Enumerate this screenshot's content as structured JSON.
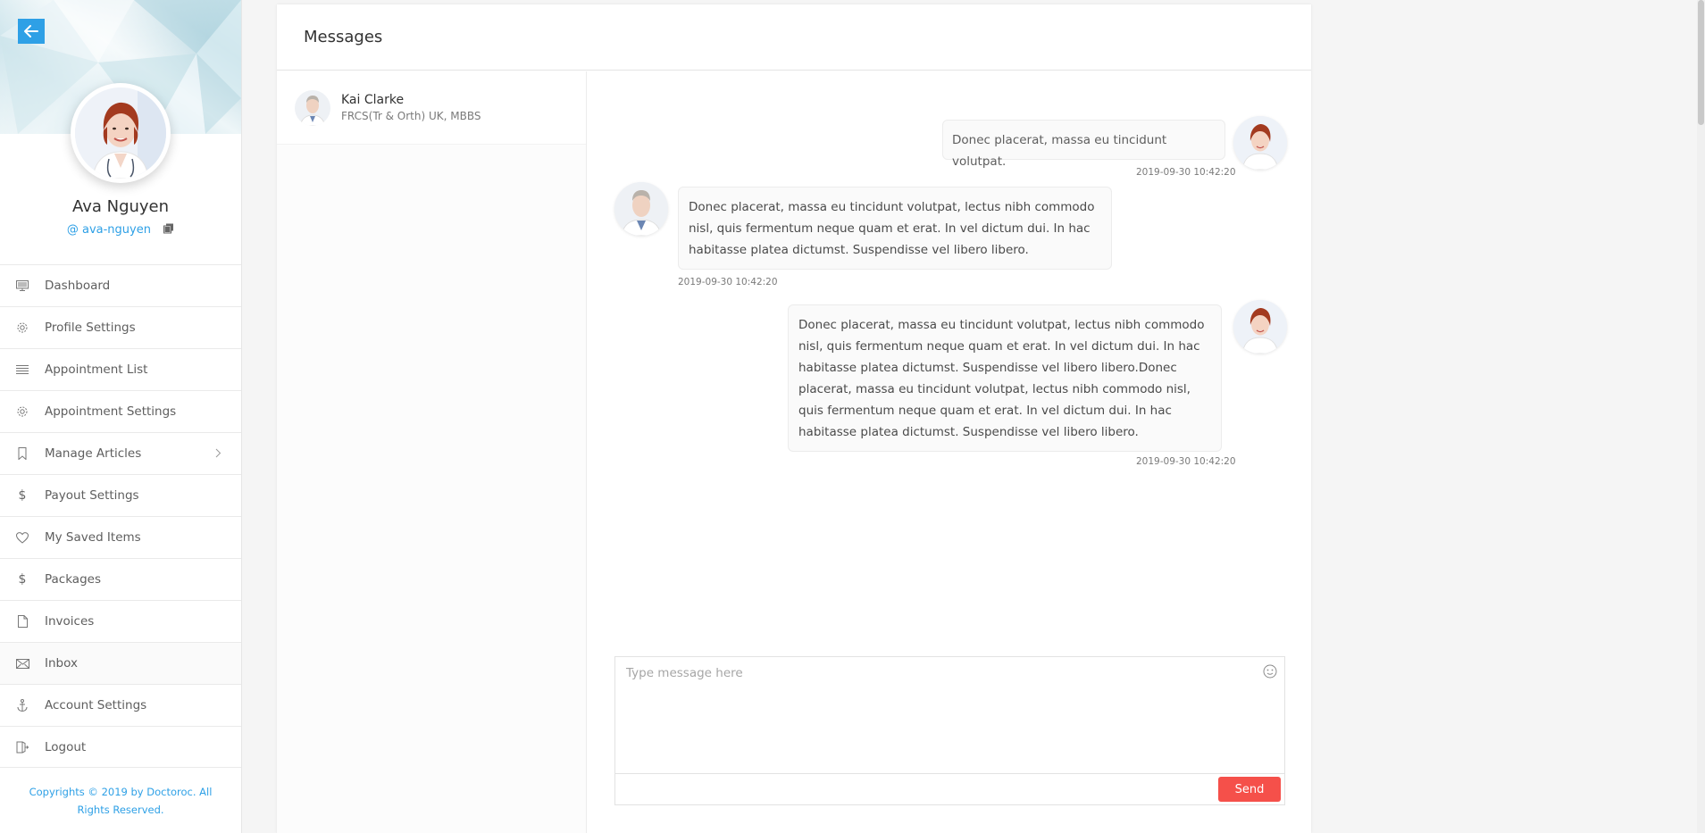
{
  "sidebar": {
    "profile": {
      "name": "Ava Nguyen",
      "handle": "@ ava-nguyen"
    },
    "items": [
      {
        "label": "Dashboard",
        "icon": "monitor-icon"
      },
      {
        "label": "Profile Settings",
        "icon": "gear-icon"
      },
      {
        "label": "Appointment List",
        "icon": "list-icon"
      },
      {
        "label": "Appointment Settings",
        "icon": "gear-icon"
      },
      {
        "label": "Manage Articles",
        "icon": "bookmark-icon",
        "has_submenu": true
      },
      {
        "label": "Payout Settings",
        "icon": "dollar-icon"
      },
      {
        "label": "My Saved Items",
        "icon": "heart-icon"
      },
      {
        "label": "Packages",
        "icon": "dollar-icon"
      },
      {
        "label": "Invoices",
        "icon": "file-icon"
      },
      {
        "label": "Inbox",
        "icon": "envelope-icon",
        "active": true
      },
      {
        "label": "Account Settings",
        "icon": "anchor-icon"
      },
      {
        "label": "Logout",
        "icon": "logout-icon"
      }
    ],
    "copyright": "Copyrights © 2019 by Doctoroc. All Rights Reserved."
  },
  "messages": {
    "title": "Messages",
    "contacts": [
      {
        "name": "Kai Clarke",
        "degree": "FRCS(Tr & Orth) UK, MBBS"
      }
    ],
    "thread": [
      {
        "from": "me",
        "text": "Donec placerat, massa eu tincidunt volutpat.",
        "time": "2019-09-30 10:42:20"
      },
      {
        "from": "other",
        "text": "Donec placerat, massa eu tincidunt volutpat, lectus nibh commodo nisl, quis fermentum neque quam et erat. In vel dictum dui. In hac habitasse platea dictumst. Suspendisse vel libero libero.",
        "time": "2019-09-30 10:42:20"
      },
      {
        "from": "me",
        "text": "Donec placerat, massa eu tincidunt volutpat, lectus nibh commodo nisl, quis fermentum neque quam et erat. In vel dictum dui. In hac habitasse platea dictumst. Suspendisse vel libero libero.Donec placerat, massa eu tincidunt volutpat, lectus nibh commodo nisl, quis fermentum neque quam et erat. In vel dictum dui. In hac habitasse platea dictumst. Suspendisse vel libero libero.",
        "time": "2019-09-30 10:42:20"
      }
    ],
    "composer": {
      "placeholder": "Type message here",
      "send_label": "Send"
    }
  },
  "colors": {
    "accent": "#2ea0e6",
    "send": "#f5504a"
  }
}
